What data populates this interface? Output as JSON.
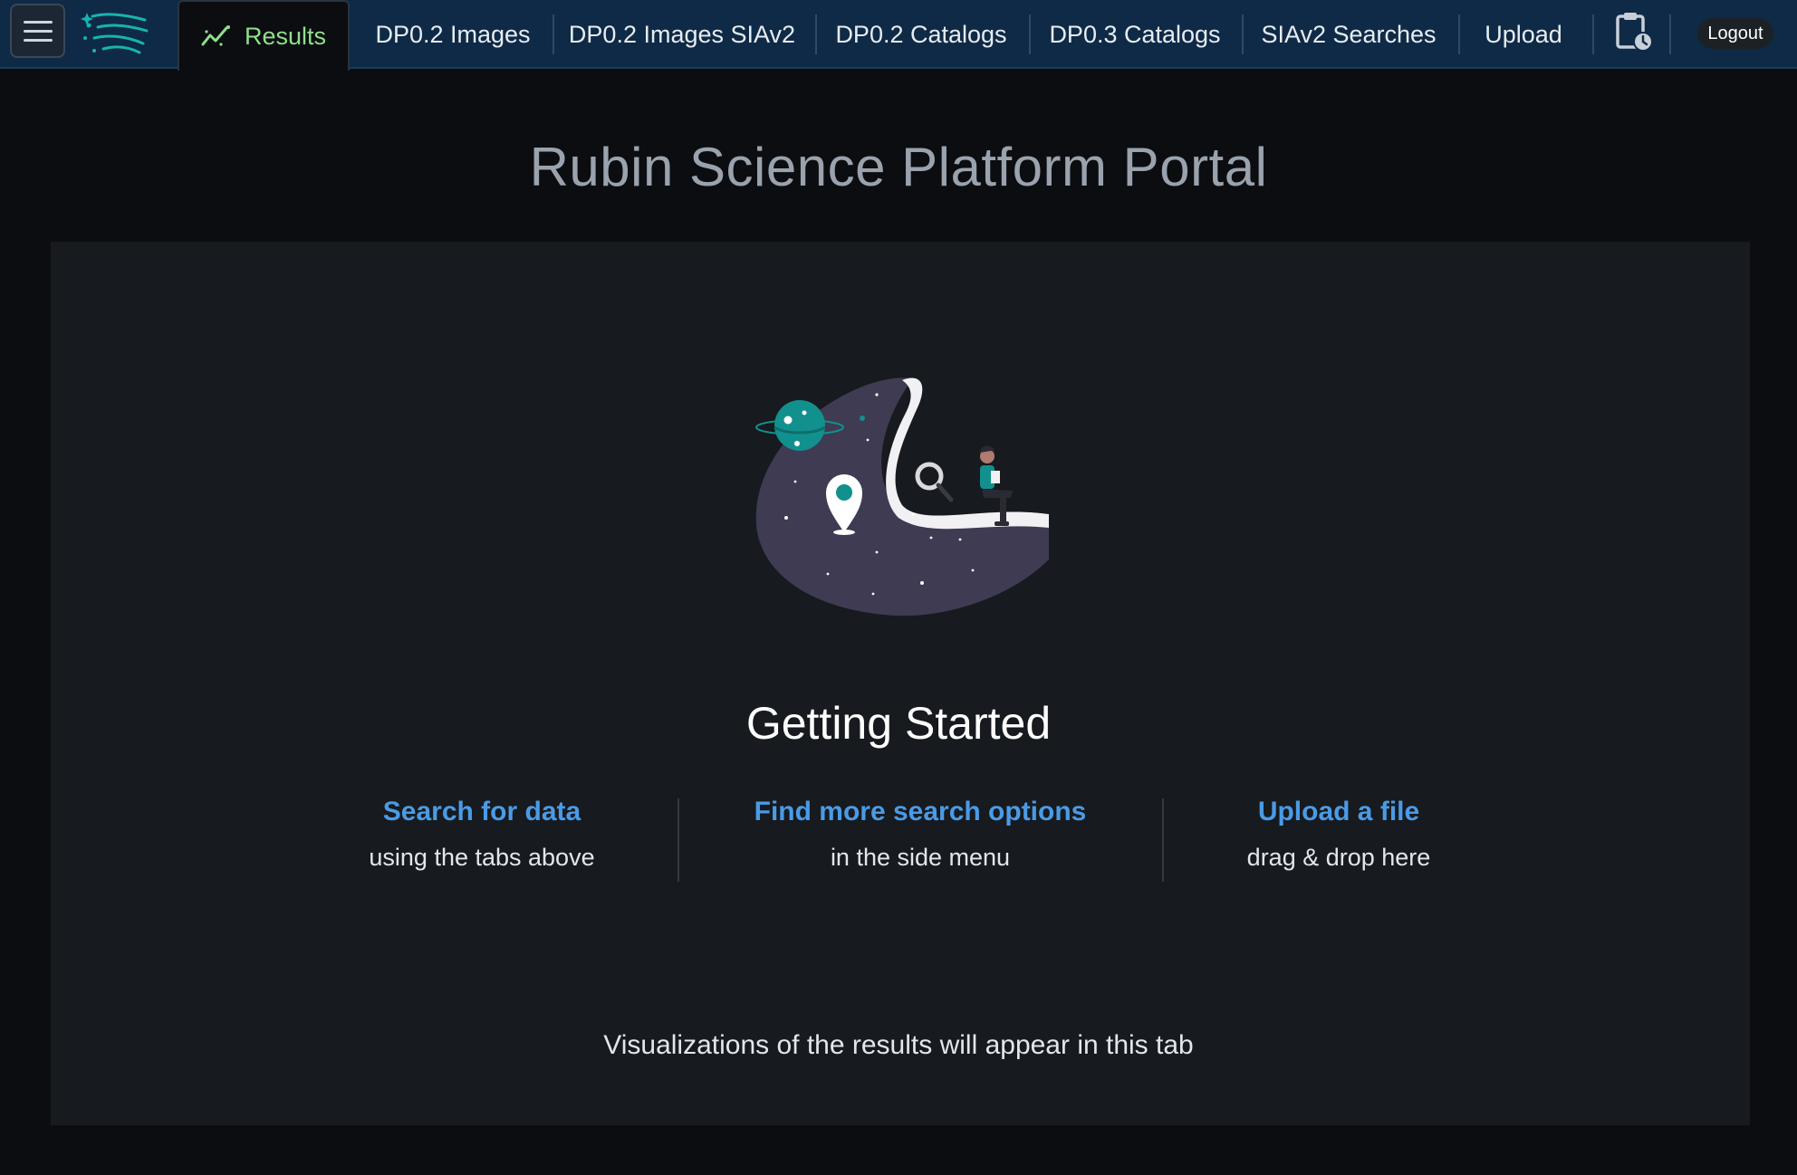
{
  "header": {
    "menu_icon": "hamburger-menu-icon",
    "logo_icon": "rubin-constellation-logo",
    "tabs": [
      {
        "label": "Results",
        "icon": "chart-line-icon",
        "active": true
      },
      {
        "label": "DP0.2 Images"
      },
      {
        "label": "DP0.2 Images SIAv2"
      },
      {
        "label": "DP0.2 Catalogs"
      },
      {
        "label": "DP0.3 Catalogs"
      },
      {
        "label": "SIAv2 Searches"
      },
      {
        "label": "Upload"
      }
    ],
    "history_icon": "clipboard-clock-icon",
    "logout_label": "Logout"
  },
  "page": {
    "title": "Rubin Science Platform Portal",
    "illustration": "space-explorer-illustration",
    "heading": "Getting Started",
    "options": [
      {
        "link": "Search for data",
        "sub": "using the tabs above"
      },
      {
        "link": "Find more search options",
        "sub": "in the side menu"
      },
      {
        "link": "Upload a file",
        "sub": "drag & drop here"
      }
    ],
    "footer_note": "Visualizations of the results will appear in this tab"
  },
  "colors": {
    "topbar_bg": "#0f2a46",
    "active_tab_text": "#8fe08b",
    "link": "#4a9be6",
    "panel_bg": "#171a1e",
    "page_bg": "#0b0d10",
    "accent_teal": "#12908e"
  }
}
